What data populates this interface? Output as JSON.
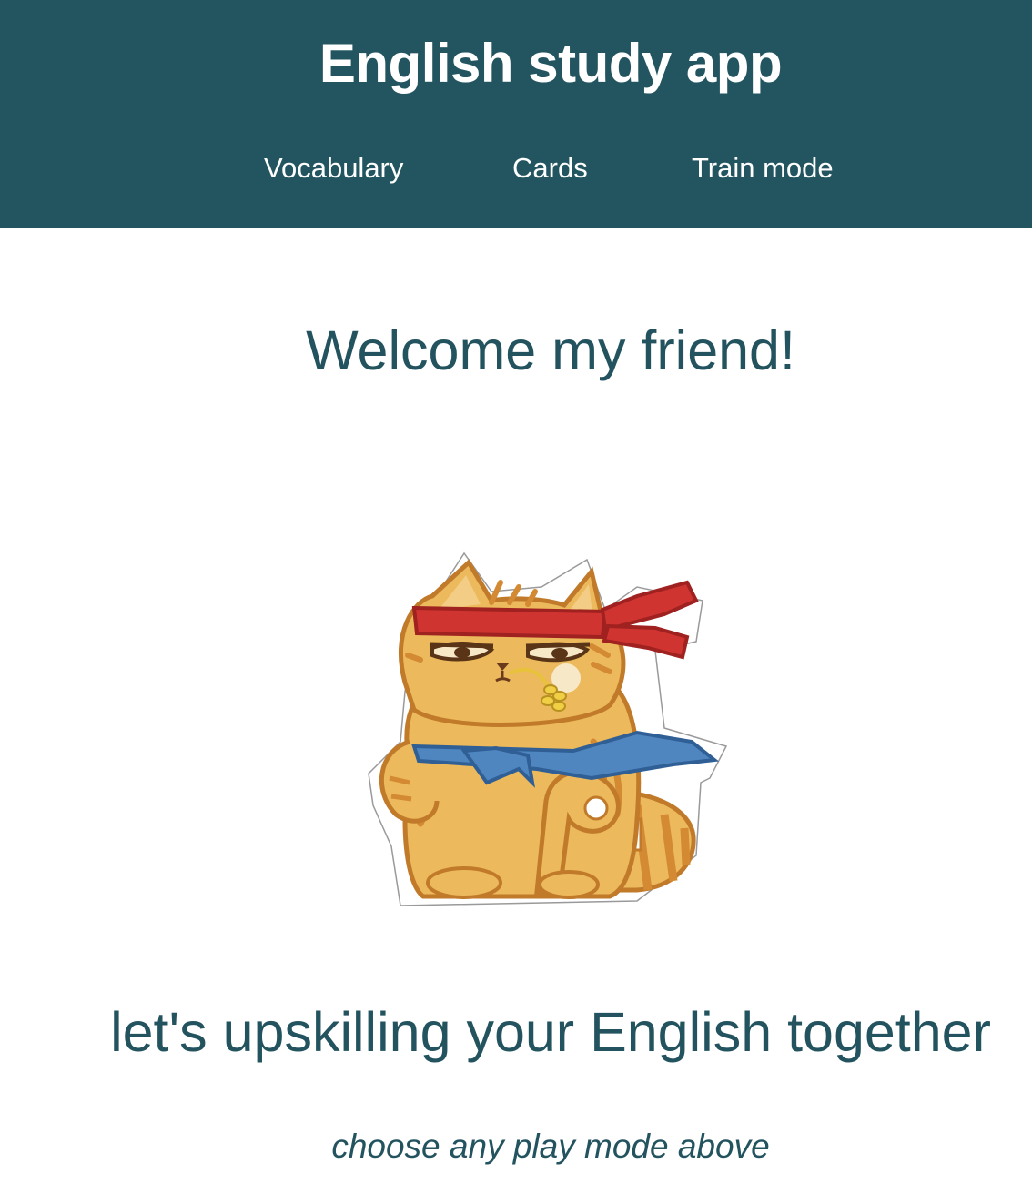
{
  "header": {
    "title": "English study app",
    "nav": {
      "vocabulary": "Vocabulary",
      "cards": "Cards",
      "train": "Train mode"
    }
  },
  "main": {
    "welcome": "Welcome my friend!",
    "illustration_icon": "cat-sticker-icon",
    "tagline": "let's upskilling your English together",
    "hint": "choose any play mode above"
  },
  "colors": {
    "header_bg": "#235560",
    "header_text": "#ffffff",
    "body_text": "#22535e",
    "cat_fur": "#ecb95c",
    "cat_stripe": "#d38a33",
    "headband": "#cf3430",
    "scarf": "#4f86c0"
  }
}
